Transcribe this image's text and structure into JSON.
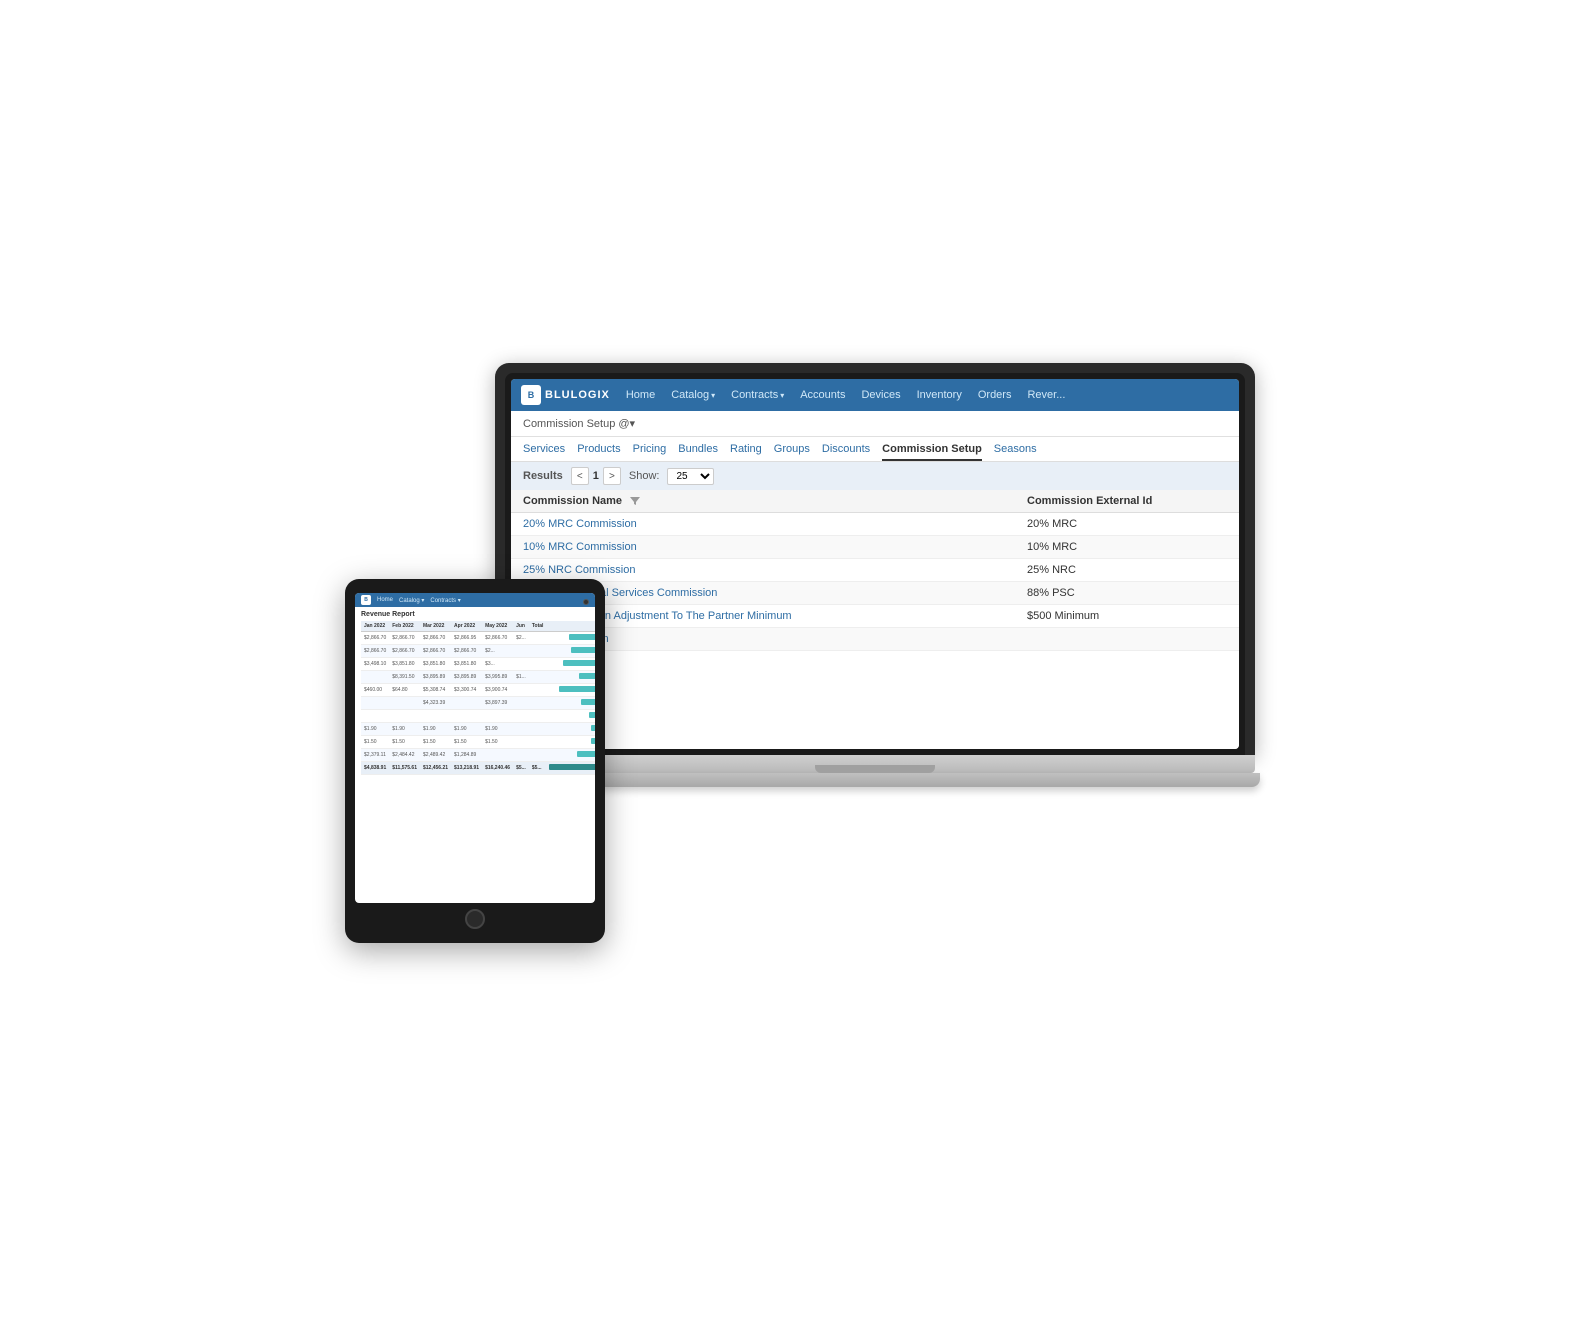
{
  "app": {
    "logo": {
      "icon": "B",
      "text": "BLULOGIX"
    },
    "nav": {
      "items": [
        {
          "label": "Home",
          "hasDropdown": false
        },
        {
          "label": "Catalog",
          "hasDropdown": true
        },
        {
          "label": "Contracts",
          "hasDropdown": true
        },
        {
          "label": "Accounts",
          "hasDropdown": false
        },
        {
          "label": "Devices",
          "hasDropdown": false
        },
        {
          "label": "Inventory",
          "hasDropdown": false
        },
        {
          "label": "Orders",
          "hasDropdown": false
        },
        {
          "label": "Rever...",
          "hasDropdown": false
        }
      ]
    },
    "breadcrumb": "Commission Setup @▾",
    "tabs": [
      {
        "label": "Services",
        "active": false
      },
      {
        "label": "Products",
        "active": false
      },
      {
        "label": "Pricing",
        "active": false
      },
      {
        "label": "Bundles",
        "active": false
      },
      {
        "label": "Rating",
        "active": false
      },
      {
        "label": "Groups",
        "active": false
      },
      {
        "label": "Discounts",
        "active": false
      },
      {
        "label": "Commission Setup",
        "active": true
      },
      {
        "label": "Seasons",
        "active": false
      }
    ],
    "toolbar": {
      "results_label": "Results",
      "page_prev": "<",
      "page_current": "1",
      "page_next": ">",
      "show_label": "Show:",
      "show_value": "25"
    },
    "table": {
      "columns": [
        {
          "label": "Commission Name"
        },
        {
          "label": "Commission External Id"
        }
      ],
      "rows": [
        {
          "name": "20% MRC Commission",
          "ext_id": "20% MRC",
          "alt": false
        },
        {
          "name": "10% MRC Commission",
          "ext_id": "10% MRC",
          "alt": true
        },
        {
          "name": "25% NRC Commission",
          "ext_id": "25% NRC",
          "alt": false
        },
        {
          "name": "88% Professional Services Commission",
          "ext_id": "88% PSC",
          "alt": true
        },
        {
          "name": "$500 Commission Adjustment To The Partner Minimum",
          "ext_id": "$500 Minimum",
          "alt": false
        },
        {
          "name": "10% Commission",
          "ext_id": "",
          "alt": true
        }
      ]
    }
  },
  "tablet": {
    "title": "Revenue Report",
    "months": [
      "Jan 2022",
      "Feb 2022",
      "Mar 2022",
      "Apr 2022",
      "May 2022",
      "Jun",
      "Total"
    ],
    "rows": [
      [
        "$2,866.70",
        "$2,866.70",
        "$2,866.70",
        "$2,866.95",
        "$2,866.70",
        "$2...",
        ""
      ],
      [
        "$2,866.70",
        "$2,866.70",
        "$2,866.70",
        "$2,866.70",
        "$2...",
        "",
        ""
      ],
      [
        "$3,498.10",
        "$3,851.80",
        "$3,851.80",
        "$3,851.80",
        "$3...",
        "",
        ""
      ],
      [
        "",
        "$8,391.50",
        "$3,895.89",
        "$3,895.89",
        "$3,995.89",
        "$1...",
        ""
      ],
      [
        "$460.00",
        "$64.80",
        "$5,308.74",
        "$3,300.74",
        "$3,900.74",
        "",
        ""
      ],
      [
        "",
        "",
        "$4,323.39",
        "",
        "$3,897.39",
        "",
        ""
      ],
      [
        "",
        "",
        "",
        "",
        "",
        "",
        ""
      ],
      [
        "$1.90",
        "$1.90",
        "$1.90",
        "$1.90",
        "$1.90",
        "",
        ""
      ],
      [
        "$1.50",
        "$1.50",
        "$1.50",
        "$1.50",
        "$1.50",
        "",
        ""
      ],
      [
        "$2,379.11",
        "$2,484.42",
        "$2,489.42",
        "$1,284.89",
        "",
        "",
        ""
      ],
      [
        "$4,838.91",
        "$11,575.61",
        "$12,456.21",
        "$13,218.91",
        "$16,240.46",
        "$5...",
        ""
      ]
    ]
  }
}
